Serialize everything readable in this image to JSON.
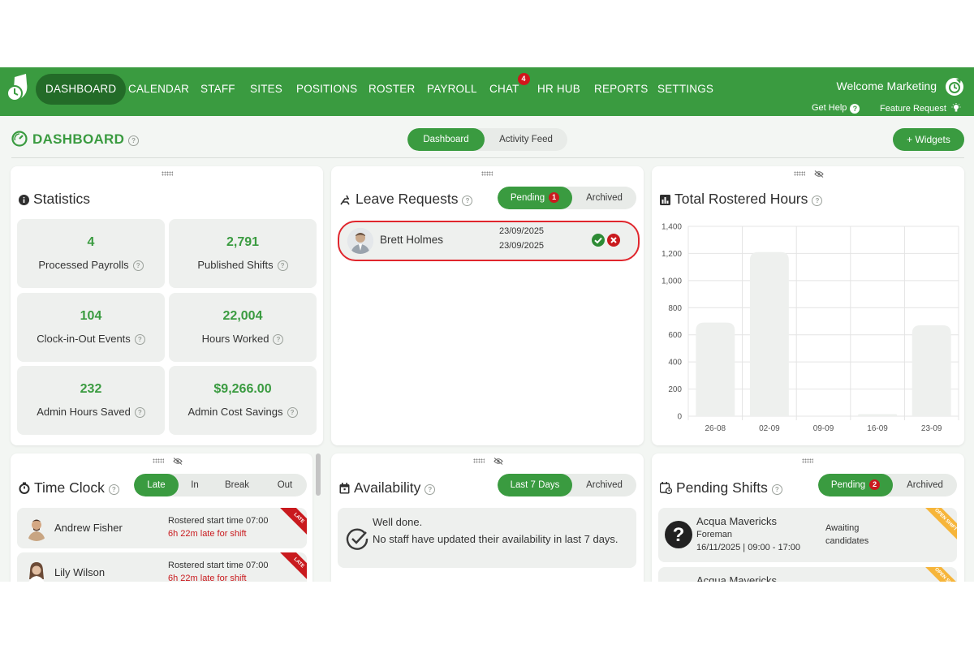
{
  "nav": {
    "items": [
      "DASHBOARD",
      "CALENDAR",
      "STAFF",
      "SITES",
      "POSITIONS",
      "ROSTER",
      "PAYROLL",
      "CHAT",
      "HR HUB",
      "REPORTS",
      "SETTINGS"
    ],
    "chat_badge": "4",
    "welcome": "Welcome Marketing",
    "get_help": "Get Help",
    "feature_request": "Feature Request"
  },
  "header": {
    "title": "DASHBOARD",
    "view_tabs": [
      "Dashboard",
      "Activity Feed"
    ],
    "widgets_button": "+ Widgets"
  },
  "statistics": {
    "title": "Statistics",
    "items": [
      {
        "value": "4",
        "label": "Processed Payrolls"
      },
      {
        "value": "2,791",
        "label": "Published Shifts"
      },
      {
        "value": "104",
        "label": "Clock-in-Out Events"
      },
      {
        "value": "22,004",
        "label": "Hours Worked"
      },
      {
        "value": "232",
        "label": "Admin Hours Saved"
      },
      {
        "value": "$9,266.00",
        "label": "Admin Cost Savings"
      }
    ]
  },
  "leave_requests": {
    "title": "Leave Requests",
    "tabs": [
      "Pending",
      "Archived"
    ],
    "pending_count": "1",
    "rows": [
      {
        "name": "Brett Holmes",
        "start": "23/09/2025",
        "end": "23/09/2025"
      }
    ]
  },
  "rostered_hours": {
    "title": "Total Rostered Hours"
  },
  "chart_data": {
    "type": "bar",
    "categories": [
      "26-08",
      "02-09",
      "09-09",
      "16-09",
      "23-09"
    ],
    "values": [
      690,
      1210,
      0,
      15,
      670
    ],
    "ylim": [
      0,
      1400
    ],
    "yticks": [
      0,
      200,
      400,
      600,
      800,
      1000,
      1200,
      1400
    ],
    "ytick_labels": [
      "0",
      "200",
      "400",
      "600",
      "800",
      "1,000",
      "1,200",
      "1,400"
    ],
    "grid": true,
    "bar_color": "#eef0ee"
  },
  "time_clock": {
    "title": "Time Clock",
    "tabs": [
      "Late",
      "In",
      "Break",
      "Out"
    ],
    "rows": [
      {
        "name": "Andrew Fisher",
        "rostered": "Rostered start time 07:00",
        "late": "6h 22m late for shift",
        "ribbon": "LATE"
      },
      {
        "name": "Lily Wilson",
        "rostered": "Rostered start time 07:00",
        "late": "6h 22m late for shift",
        "ribbon": "LATE"
      }
    ]
  },
  "availability": {
    "title": "Availability",
    "tabs": [
      "Last 7 Days",
      "Archived"
    ],
    "message_title": "Well done.",
    "message_body": "No staff have updated their availability in last 7 days."
  },
  "pending_shifts": {
    "title": "Pending Shifts",
    "tabs": [
      "Pending",
      "Archived"
    ],
    "pending_count": "2",
    "rows": [
      {
        "site": "Acqua Mavericks",
        "position": "Foreman",
        "when": "16/11/2025 | 09:00 - 17:00",
        "status": "Awaiting candidates",
        "ribbon": "OPEN SHIFT"
      },
      {
        "site": "Acqua Mavericks",
        "ribbon": "OPEN SHIFT"
      }
    ]
  },
  "colors": {
    "brand": "#3a9b40",
    "brand_dark": "#236b28",
    "danger": "#c91a1e",
    "highlight": "#e0262d"
  }
}
